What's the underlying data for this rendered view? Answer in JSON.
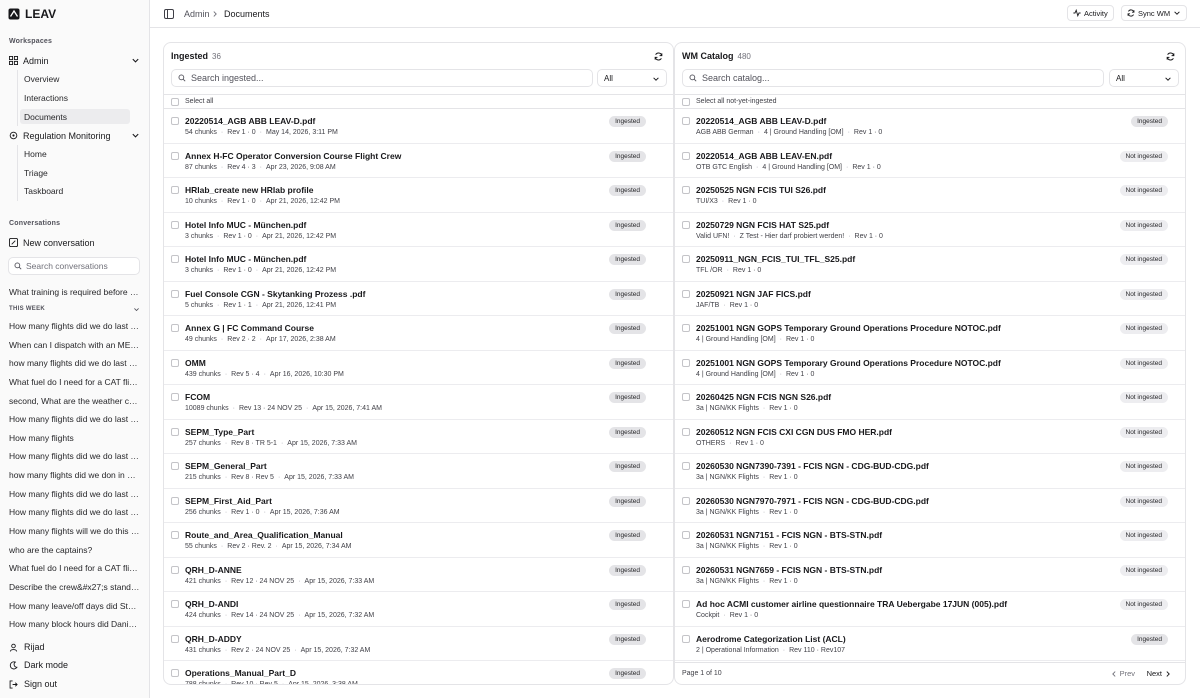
{
  "brand": "LEAV",
  "sidebar": {
    "workspaces_label": "Workspaces",
    "admin": {
      "label": "Admin",
      "items": [
        "Overview",
        "Interactions",
        "Documents"
      ]
    },
    "regulation": {
      "label": "Regulation Monitoring",
      "items": [
        "Home",
        "Triage",
        "Taskboard"
      ]
    },
    "conversations_label": "Conversations",
    "new_conversation": "New conversation",
    "search_placeholder": "Search conversations",
    "pinned": [
      "What training is required before fl..."
    ],
    "this_week_label": "THIS WEEK",
    "this_week": [
      "How many flights did we do last week?",
      "When can I dispatch with an MEL item",
      "how many flights did we do last week",
      "What fuel do I need for a CAT flight",
      "second, What are the weather conditions",
      "How many flights did we do last month",
      "How many flights",
      "How many flights did we do last year",
      "how many flights did we don in 2026",
      "How many flights did we do last month",
      "How many flights did we do last week",
      "How many flights will we do this week",
      "who are the captains?",
      "What fuel do I need for a CAT flight",
      "Describe the crew&#x27;s standard",
      "How many leave/off days did Stefan take",
      "How many block hours did Daniel fly"
    ],
    "bottom": [
      "Rijad",
      "Dark mode",
      "Sign out"
    ]
  },
  "topbar": {
    "breadcrumb": [
      "Admin",
      "Documents"
    ],
    "activity": "Activity",
    "sync": "Sync WM"
  },
  "ingested": {
    "title": "Ingested",
    "count": "36",
    "search_placeholder": "Search ingested...",
    "filter": "All",
    "select_all": "Select all",
    "rows": [
      {
        "name": "20220514_AGB ABB LEAV-D.pdf",
        "meta": [
          "54 chunks",
          "Rev 1 · 0",
          "May 14, 2026, 3:11 PM"
        ],
        "status": "Ingested"
      },
      {
        "name": "Annex H-FC Operator Conversion Course Flight Crew",
        "meta": [
          "87 chunks",
          "Rev 4 · 3",
          "Apr 23, 2026, 9:08 AM"
        ],
        "status": "Ingested"
      },
      {
        "name": "HRlab_create new HRlab profile",
        "meta": [
          "10 chunks",
          "Rev 1 · 0",
          "Apr 21, 2026, 12:42 PM"
        ],
        "status": "Ingested"
      },
      {
        "name": "Hotel Info MUC - München.pdf",
        "meta": [
          "3 chunks",
          "Rev 1 · 0",
          "Apr 21, 2026, 12:42 PM"
        ],
        "status": "Ingested"
      },
      {
        "name": "Hotel Info MUC - München.pdf",
        "meta": [
          "3 chunks",
          "Rev 1 · 0",
          "Apr 21, 2026, 12:42 PM"
        ],
        "status": "Ingested"
      },
      {
        "name": "Fuel Console CGN - Skytanking Prozess .pdf",
        "meta": [
          "5 chunks",
          "Rev 1 · 1",
          "Apr 21, 2026, 12:41 PM"
        ],
        "status": "Ingested"
      },
      {
        "name": "Annex G | FC Command Course",
        "meta": [
          "49 chunks",
          "Rev 2 · 2",
          "Apr 17, 2026, 2:38 AM"
        ],
        "status": "Ingested"
      },
      {
        "name": "OMM",
        "meta": [
          "439 chunks",
          "Rev 5 · 4",
          "Apr 16, 2026, 10:30 PM"
        ],
        "status": "Ingested"
      },
      {
        "name": "FCOM",
        "meta": [
          "10089 chunks",
          "Rev 13 · 24 NOV 25",
          "Apr 15, 2026, 7:41 AM"
        ],
        "status": "Ingested"
      },
      {
        "name": "SEPM_Type_Part",
        "meta": [
          "257 chunks",
          "Rev 8 · TR 5-1",
          "Apr 15, 2026, 7:33 AM"
        ],
        "status": "Ingested"
      },
      {
        "name": "SEPM_General_Part",
        "meta": [
          "215 chunks",
          "Rev 8 · Rev 5",
          "Apr 15, 2026, 7:33 AM"
        ],
        "status": "Ingested"
      },
      {
        "name": "SEPM_First_Aid_Part",
        "meta": [
          "256 chunks",
          "Rev 1 · 0",
          "Apr 15, 2026, 7:36 AM"
        ],
        "status": "Ingested"
      },
      {
        "name": "Route_and_Area_Qualification_Manual",
        "meta": [
          "55 chunks",
          "Rev 2 · Rev. 2",
          "Apr 15, 2026, 7:34 AM"
        ],
        "status": "Ingested"
      },
      {
        "name": "QRH_D-ANNE",
        "meta": [
          "421 chunks",
          "Rev 12 · 24 NOV 25",
          "Apr 15, 2026, 7:33 AM"
        ],
        "status": "Ingested"
      },
      {
        "name": "QRH_D-ANDI",
        "meta": [
          "424 chunks",
          "Rev 14 · 24 NOV 25",
          "Apr 15, 2026, 7:32 AM"
        ],
        "status": "Ingested"
      },
      {
        "name": "QRH_D-ADDY",
        "meta": [
          "431 chunks",
          "Rev 2 · 24 NOV 25",
          "Apr 15, 2026, 7:32 AM"
        ],
        "status": "Ingested"
      },
      {
        "name": "Operations_Manual_Part_D",
        "meta": [
          "788 chunks",
          "Rev 10 · Rev 5",
          "Apr 15, 2026, 3:38 AM"
        ],
        "status": "Ingested"
      }
    ]
  },
  "catalog": {
    "title": "WM Catalog",
    "count": "480",
    "search_placeholder": "Search catalog...",
    "filter": "All",
    "select_all": "Select all not-yet-ingested",
    "rows": [
      {
        "name": "20220514_AGB ABB LEAV-D.pdf",
        "meta": [
          "AGB ABB German",
          "4 | Ground Handling [OM]",
          "Rev 1 · 0"
        ],
        "status": "Ingested"
      },
      {
        "name": "20220514_AGB ABB LEAV-EN.pdf",
        "meta": [
          "OTB GTC English",
          "4 | Ground Handling [OM]",
          "Rev 1 · 0"
        ],
        "status": "Not ingested"
      },
      {
        "name": "20250525 NGN FCIS TUI S26.pdf",
        "meta": [
          "TUI/X3",
          "Rev 1 · 0"
        ],
        "status": "Not ingested"
      },
      {
        "name": "20250729 NGN FCIS HAT S25.pdf",
        "meta": [
          "Valid UFN!",
          "Z Test - Hier darf probiert werden!",
          "Rev 1 · 0"
        ],
        "status": "Not ingested"
      },
      {
        "name": "20250911_NGN_FCIS_TUI_TFL_S25.pdf",
        "meta": [
          "TFL /OR",
          "Rev 1 · 0"
        ],
        "status": "Not ingested"
      },
      {
        "name": "20250921 NGN JAF FICS.pdf",
        "meta": [
          "JAF/TB",
          "Rev 1 · 0"
        ],
        "status": "Not ingested"
      },
      {
        "name": "20251001 NGN GOPS Temporary Ground Operations Procedure NOTOC.pdf",
        "meta": [
          "4 | Ground Handling [OM]",
          "Rev 1 · 0"
        ],
        "status": "Not ingested"
      },
      {
        "name": "20251001 NGN GOPS Temporary Ground Operations Procedure NOTOC.pdf",
        "meta": [
          "4 | Ground Handling [OM]",
          "Rev 1 · 0"
        ],
        "status": "Not ingested"
      },
      {
        "name": "20260425 NGN FCIS NGN S26.pdf",
        "meta": [
          "3a | NGN/KK Flights",
          "Rev 1 · 0"
        ],
        "status": "Not ingested"
      },
      {
        "name": "20260512 NGN FCIS CXI CGN DUS FMO HER.pdf",
        "meta": [
          "OTHERS",
          "Rev 1 · 0"
        ],
        "status": "Not ingested"
      },
      {
        "name": "20260530 NGN7390-7391 - FCIS NGN - CDG-BUD-CDG.pdf",
        "meta": [
          "3a | NGN/KK Flights",
          "Rev 1 · 0"
        ],
        "status": "Not ingested"
      },
      {
        "name": "20260530 NGN7970-7971 - FCIS NGN - CDG-BUD-CDG.pdf",
        "meta": [
          "3a | NGN/KK Flights",
          "Rev 1 · 0"
        ],
        "status": "Not ingested"
      },
      {
        "name": "20260531 NGN7151 - FCIS NGN - BTS-STN.pdf",
        "meta": [
          "3a | NGN/KK Flights",
          "Rev 1 · 0"
        ],
        "status": "Not ingested"
      },
      {
        "name": "20260531 NGN7659 - FCIS NGN - BTS-STN.pdf",
        "meta": [
          "3a | NGN/KK Flights",
          "Rev 1 · 0"
        ],
        "status": "Not ingested"
      },
      {
        "name": "Ad hoc ACMI customer airline questionnaire TRA Uebergabe 17JUN (005).pdf",
        "meta": [
          "Cockpit",
          "Rev 1 · 0"
        ],
        "status": "Not ingested"
      },
      {
        "name": "Aerodrome Categorization List (ACL)",
        "meta": [
          "2 | Operational Information",
          "Rev 110 · Rev107"
        ],
        "status": "Ingested"
      }
    ],
    "page_info": "Page 1 of 10",
    "prev": "Prev",
    "next": "Next"
  }
}
